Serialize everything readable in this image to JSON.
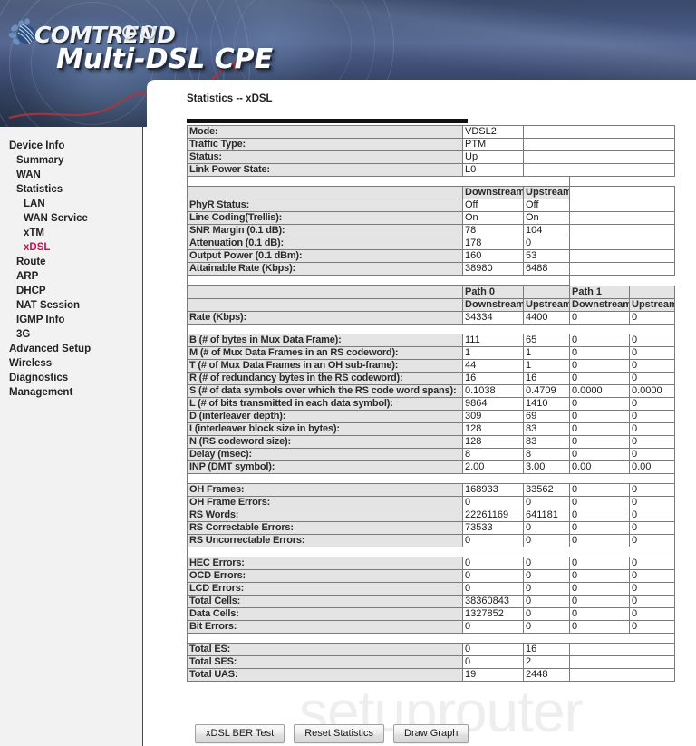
{
  "header": {
    "brand": "COMTREND",
    "product": "Multi-DSL CPE",
    "logo_icon": "comtrend-flower-logo-icon"
  },
  "watermark": "setuprouter",
  "sidebar": {
    "items": [
      {
        "label": "Device Info",
        "level": 1,
        "active": false
      },
      {
        "label": "Summary",
        "level": 2,
        "active": false
      },
      {
        "label": "WAN",
        "level": 2,
        "active": false
      },
      {
        "label": "Statistics",
        "level": 2,
        "active": false
      },
      {
        "label": "LAN",
        "level": 3,
        "active": false
      },
      {
        "label": "WAN Service",
        "level": 3,
        "active": false
      },
      {
        "label": "xTM",
        "level": 3,
        "active": false
      },
      {
        "label": "xDSL",
        "level": 3,
        "active": true
      },
      {
        "label": "Route",
        "level": 2,
        "active": false
      },
      {
        "label": "ARP",
        "level": 2,
        "active": false
      },
      {
        "label": "DHCP",
        "level": 2,
        "active": false
      },
      {
        "label": "NAT Session",
        "level": 2,
        "active": false
      },
      {
        "label": "IGMP Info",
        "level": 2,
        "active": false
      },
      {
        "label": "3G",
        "level": 2,
        "active": false
      },
      {
        "label": "Advanced Setup",
        "level": 1,
        "active": false
      },
      {
        "label": "Wireless",
        "level": 1,
        "active": false
      },
      {
        "label": "Diagnostics",
        "level": 1,
        "active": false
      },
      {
        "label": "Management",
        "level": 1,
        "active": false
      }
    ]
  },
  "page": {
    "title": "Statistics -- xDSL"
  },
  "table1": {
    "line_rows": [
      {
        "label": "Mode:",
        "value": "VDSL2"
      },
      {
        "label": "Traffic Type:",
        "value": "PTM"
      },
      {
        "label": "Status:",
        "value": "Up"
      },
      {
        "label": "Link Power State:",
        "value": "L0"
      }
    ],
    "headers": [
      "",
      "Downstream",
      "Upstream"
    ],
    "rows": [
      {
        "label": "PhyR Status:",
        "ds": "Off",
        "us": "Off"
      },
      {
        "label": "Line Coding(Trellis):",
        "ds": "On",
        "us": "On"
      },
      {
        "label": "SNR Margin (0.1 dB):",
        "ds": "78",
        "us": "104"
      },
      {
        "label": "Attenuation (0.1 dB):",
        "ds": "178",
        "us": "0"
      },
      {
        "label": "Output Power (0.1 dBm):",
        "ds": "160",
        "us": "53"
      },
      {
        "label": "Attainable Rate (Kbps):",
        "ds": "38980",
        "us": "6488"
      }
    ]
  },
  "table2": {
    "path_headers": [
      "",
      "Path 0",
      "",
      "Path 1",
      ""
    ],
    "dir_headers": [
      "",
      "Downstream",
      "Upstream",
      "Downstream",
      "Upstream"
    ],
    "rate_row": {
      "label": "Rate (Kbps):",
      "p0ds": "34334",
      "p0us": "4400",
      "p1ds": "0",
      "p1us": "0"
    },
    "group_frame": [
      {
        "label": "B (# of bytes in Mux Data Frame):",
        "p0ds": "111",
        "p0us": "65",
        "p1ds": "0",
        "p1us": "0"
      },
      {
        "label": "M (# of Mux Data Frames in an RS codeword):",
        "p0ds": "1",
        "p0us": "1",
        "p1ds": "0",
        "p1us": "0"
      },
      {
        "label": "T (# of Mux Data Frames in an OH sub-frame):",
        "p0ds": "44",
        "p0us": "1",
        "p1ds": "0",
        "p1us": "0"
      },
      {
        "label": "R (# of redundancy bytes in the RS codeword):",
        "p0ds": "16",
        "p0us": "16",
        "p1ds": "0",
        "p1us": "0"
      },
      {
        "label": "S (# of data symbols over which the RS code word spans):",
        "p0ds": "0.1038",
        "p0us": "0.4709",
        "p1ds": "0.0000",
        "p1us": "0.0000"
      },
      {
        "label": "L (# of bits transmitted in each data symbol):",
        "p0ds": "9864",
        "p0us": "1410",
        "p1ds": "0",
        "p1us": "0"
      },
      {
        "label": "D (interleaver depth):",
        "p0ds": "309",
        "p0us": "69",
        "p1ds": "0",
        "p1us": "0"
      },
      {
        "label": "I (interleaver block size in bytes):",
        "p0ds": "128",
        "p0us": "83",
        "p1ds": "0",
        "p1us": "0"
      },
      {
        "label": "N (RS codeword size):",
        "p0ds": "128",
        "p0us": "83",
        "p1ds": "0",
        "p1us": "0"
      },
      {
        "label": "Delay (msec):",
        "p0ds": "8",
        "p0us": "8",
        "p1ds": "0",
        "p1us": "0"
      },
      {
        "label": "INP (DMT symbol):",
        "p0ds": "2.00",
        "p0us": "3.00",
        "p1ds": "0.00",
        "p1us": "0.00"
      }
    ],
    "group_oh": [
      {
        "label": "OH Frames:",
        "p0ds": "168933",
        "p0us": "33562",
        "p1ds": "0",
        "p1us": "0"
      },
      {
        "label": "OH Frame Errors:",
        "p0ds": "0",
        "p0us": "0",
        "p1ds": "0",
        "p1us": "0"
      },
      {
        "label": "RS Words:",
        "p0ds": "22261169",
        "p0us": "641181",
        "p1ds": "0",
        "p1us": "0"
      },
      {
        "label": "RS Correctable Errors:",
        "p0ds": "73533",
        "p0us": "0",
        "p1ds": "0",
        "p1us": "0"
      },
      {
        "label": "RS Uncorrectable Errors:",
        "p0ds": "0",
        "p0us": "0",
        "p1ds": "0",
        "p1us": "0"
      }
    ],
    "group_cells": [
      {
        "label": "HEC Errors:",
        "p0ds": "0",
        "p0us": "0",
        "p1ds": "0",
        "p1us": "0"
      },
      {
        "label": "OCD Errors:",
        "p0ds": "0",
        "p0us": "0",
        "p1ds": "0",
        "p1us": "0"
      },
      {
        "label": "LCD Errors:",
        "p0ds": "0",
        "p0us": "0",
        "p1ds": "0",
        "p1us": "0"
      },
      {
        "label": "Total Cells:",
        "p0ds": "38360843",
        "p0us": "0",
        "p1ds": "0",
        "p1us": "0"
      },
      {
        "label": "Data Cells:",
        "p0ds": "1327852",
        "p0us": "0",
        "p1ds": "0",
        "p1us": "0"
      },
      {
        "label": "Bit Errors:",
        "p0ds": "0",
        "p0us": "0",
        "p1ds": "0",
        "p1us": "0"
      }
    ],
    "group_totals": [
      {
        "label": "Total ES:",
        "ds": "0",
        "us": "16"
      },
      {
        "label": "Total SES:",
        "ds": "0",
        "us": "2"
      },
      {
        "label": "Total UAS:",
        "ds": "19",
        "us": "2448"
      }
    ]
  },
  "buttons": [
    {
      "label": "xDSL BER Test"
    },
    {
      "label": "Reset Statistics"
    },
    {
      "label": "Draw Graph"
    }
  ]
}
